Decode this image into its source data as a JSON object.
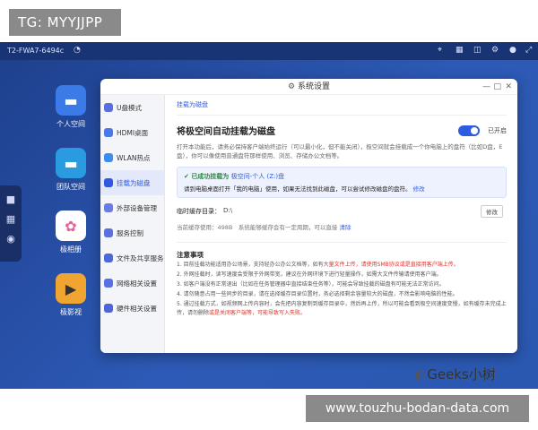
{
  "overlay": {
    "tg_label": "TG: MYYJJPP",
    "url_label": "www.touzhu-bodan-data.com",
    "watermark": "Geeks小树"
  },
  "topbar": {
    "device_name": "T2-FWA7-6494c"
  },
  "desktop_apps": [
    {
      "label": "个人空间",
      "icon": "folder-icon",
      "color": "#3b7be8"
    },
    {
      "label": "团队空间",
      "icon": "team-folder-icon",
      "color": "#2a9be0"
    },
    {
      "label": "极相册",
      "icon": "photos-icon",
      "color": "#ffffff"
    },
    {
      "label": "极影视",
      "icon": "video-icon",
      "color": "#f0a531"
    }
  ],
  "window": {
    "title": "系统设置",
    "sidebar": [
      {
        "label": "U盘模式",
        "color": "#5b6ee0"
      },
      {
        "label": "HDMI桌面",
        "color": "#4a78e8"
      },
      {
        "label": "WLAN热点",
        "color": "#3b8df0"
      },
      {
        "label": "挂载为磁盘",
        "color": "#2f5be0"
      },
      {
        "label": "外部设备管理",
        "color": "#6a7ae6"
      },
      {
        "label": "服务控制",
        "color": "#5a6fe0"
      },
      {
        "label": "文件及共享服务",
        "color": "#4c69d9"
      },
      {
        "label": "网络相关设置",
        "color": "#5672e2"
      },
      {
        "label": "硬件相关设置",
        "color": "#4d65d6"
      }
    ],
    "breadcrumb": "挂载为磁盘",
    "section_title": "将极空间自动挂载为磁盘",
    "toggle_label": "已开启",
    "description": "打开本功能后，请务必保持客户端始终运行（可以最小化，但不能关闭），极空间就会挂载成一个你电脑上的盘符（比如D盘，E盘），你可以像使用普通盘符那样使用、浏览、存储办公文档等。",
    "notice": {
      "line1_prefix": "已成功挂载为",
      "line1_target": "极空间-个人 (Z:)盘",
      "line2": "请到电脑桌面打开「我的电脑」使用，如果无法找到此磁盘，可以尝试修改磁盘的盘符。",
      "line2_link": "修改"
    },
    "cache": {
      "label": "临时缓存目录：",
      "value": "D:\\",
      "button": "修改",
      "sub": "当前缓存使用：498B　系统能够缓存会有一定周期，可以直接",
      "sub_link": "清除"
    },
    "notes_title": "注意事项",
    "notes": [
      "1. 目前挂载功能适用办公场景，支持轻办公办公文档等，如有",
      "2. 外网挂载时，读写速度会受限于外网带宽，建议在外网环境下进行轻量操作，如需大文件传输请使用客户端。",
      "3. 如客户端没有正常退出（比如在任务管理器中直接结束任务等），可能会导致挂载的磁盘有可能无法正常访问。",
      "4. 请勿随意占用一些同步的目录，请在选择缓存目录位置时，务必选择剩余容量较大的磁盘，不然会影响电脑的性能。",
      "5. 通过挂载方式，如视频网上传内容时，会先把内容复制到缓存目录中，然后再上传，所以可能会看到极空间速度变慢，如有缓存未完成上传，请勿删除"
    ],
    "note_red_1": "大量文件上传，请使用SMB协议或是直接用客户端上传。",
    "note_red_5": "或是关闭客户端等，可能导致写入失败。"
  }
}
